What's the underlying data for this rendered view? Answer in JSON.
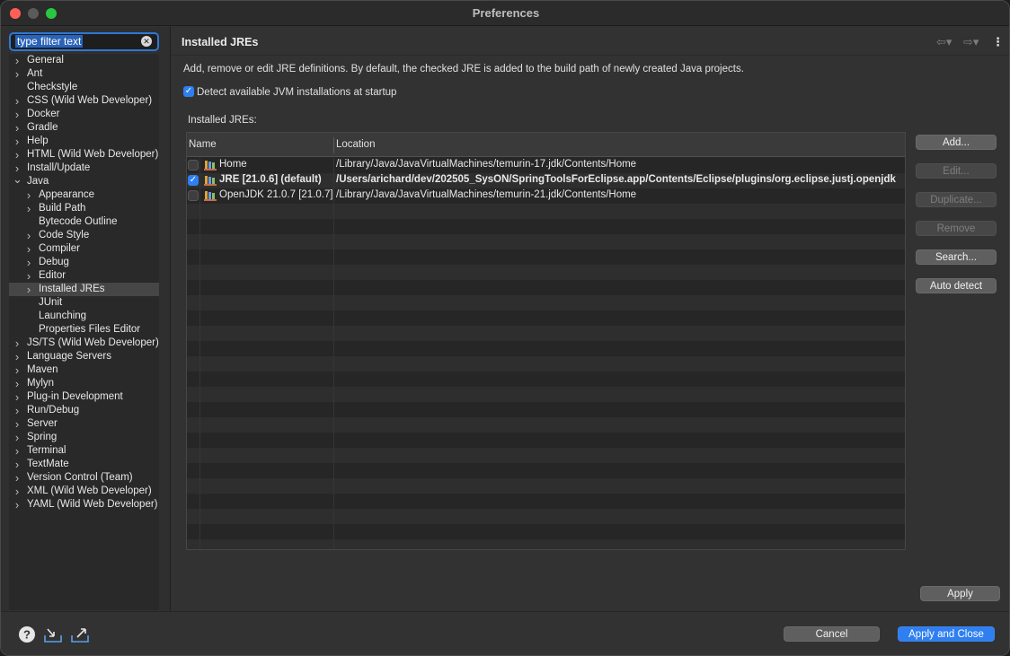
{
  "window": {
    "title": "Preferences"
  },
  "sidebar": {
    "filter_text": "type filter text",
    "items": [
      {
        "label": "General",
        "expandable": true,
        "expanded": false,
        "level": 0
      },
      {
        "label": "Ant",
        "expandable": true,
        "expanded": false,
        "level": 0
      },
      {
        "label": "Checkstyle",
        "expandable": false,
        "expanded": false,
        "level": 0
      },
      {
        "label": "CSS (Wild Web Developer)",
        "expandable": true,
        "expanded": false,
        "level": 0
      },
      {
        "label": "Docker",
        "expandable": true,
        "expanded": false,
        "level": 0
      },
      {
        "label": "Gradle",
        "expandable": true,
        "expanded": false,
        "level": 0
      },
      {
        "label": "Help",
        "expandable": true,
        "expanded": false,
        "level": 0
      },
      {
        "label": "HTML (Wild Web Developer)",
        "expandable": true,
        "expanded": false,
        "level": 0
      },
      {
        "label": "Install/Update",
        "expandable": true,
        "expanded": false,
        "level": 0
      },
      {
        "label": "Java",
        "expandable": true,
        "expanded": true,
        "level": 0
      },
      {
        "label": "Appearance",
        "expandable": true,
        "expanded": false,
        "level": 1
      },
      {
        "label": "Build Path",
        "expandable": true,
        "expanded": false,
        "level": 1
      },
      {
        "label": "Bytecode Outline",
        "expandable": false,
        "expanded": false,
        "level": 1
      },
      {
        "label": "Code Style",
        "expandable": true,
        "expanded": false,
        "level": 1
      },
      {
        "label": "Compiler",
        "expandable": true,
        "expanded": false,
        "level": 1
      },
      {
        "label": "Debug",
        "expandable": true,
        "expanded": false,
        "level": 1
      },
      {
        "label": "Editor",
        "expandable": true,
        "expanded": false,
        "level": 1
      },
      {
        "label": "Installed JREs",
        "expandable": true,
        "expanded": false,
        "level": 1,
        "selected": true
      },
      {
        "label": "JUnit",
        "expandable": false,
        "expanded": false,
        "level": 1
      },
      {
        "label": "Launching",
        "expandable": false,
        "expanded": false,
        "level": 1
      },
      {
        "label": "Properties Files Editor",
        "expandable": false,
        "expanded": false,
        "level": 1
      },
      {
        "label": "JS/TS (Wild Web Developer)",
        "expandable": true,
        "expanded": false,
        "level": 0
      },
      {
        "label": "Language Servers",
        "expandable": true,
        "expanded": false,
        "level": 0
      },
      {
        "label": "Maven",
        "expandable": true,
        "expanded": false,
        "level": 0
      },
      {
        "label": "Mylyn",
        "expandable": true,
        "expanded": false,
        "level": 0
      },
      {
        "label": "Plug-in Development",
        "expandable": true,
        "expanded": false,
        "level": 0
      },
      {
        "label": "Run/Debug",
        "expandable": true,
        "expanded": false,
        "level": 0
      },
      {
        "label": "Server",
        "expandable": true,
        "expanded": false,
        "level": 0
      },
      {
        "label": "Spring",
        "expandable": true,
        "expanded": false,
        "level": 0
      },
      {
        "label": "Terminal",
        "expandable": true,
        "expanded": false,
        "level": 0
      },
      {
        "label": "TextMate",
        "expandable": true,
        "expanded": false,
        "level": 0
      },
      {
        "label": "Version Control (Team)",
        "expandable": true,
        "expanded": false,
        "level": 0
      },
      {
        "label": "XML (Wild Web Developer)",
        "expandable": true,
        "expanded": false,
        "level": 0
      },
      {
        "label": "YAML (Wild Web Developer)",
        "expandable": true,
        "expanded": false,
        "level": 0
      }
    ]
  },
  "page": {
    "title": "Installed JREs",
    "description": "Add, remove or edit JRE definitions. By default, the checked JRE is added to the build path of newly created Java projects.",
    "detect_label": "Detect available JVM installations at startup",
    "detect_checked": true,
    "table_label": "Installed JREs:",
    "columns": {
      "name": "Name",
      "location": "Location"
    },
    "rows": [
      {
        "name": "Home",
        "location": "/Library/Java/JavaVirtualMachines/temurin-17.jdk/Contents/Home",
        "checked": false,
        "bold": false
      },
      {
        "name": "JRE [21.0.6] (default)",
        "location": "/Users/arichard/dev/202505_SysON/SpringToolsForEclipse.app/Contents/Eclipse/plugins/org.eclipse.justj.openjdk",
        "checked": true,
        "bold": true
      },
      {
        "name": "OpenJDK 21.0.7 [21.0.7]",
        "location": "/Library/Java/JavaVirtualMachines/temurin-21.jdk/Contents/Home",
        "checked": false,
        "bold": false
      }
    ],
    "buttons": {
      "add": "Add...",
      "edit": "Edit...",
      "duplicate": "Duplicate...",
      "remove": "Remove",
      "search": "Search...",
      "auto_detect": "Auto detect"
    },
    "apply": "Apply"
  },
  "footer": {
    "cancel": "Cancel",
    "apply_close": "Apply and Close",
    "icons": [
      "help-icon",
      "import-icon",
      "export-icon"
    ]
  },
  "colors": {
    "accent": "#2f7ff0",
    "close": "#ff5f57",
    "maximize": "#28c840"
  }
}
